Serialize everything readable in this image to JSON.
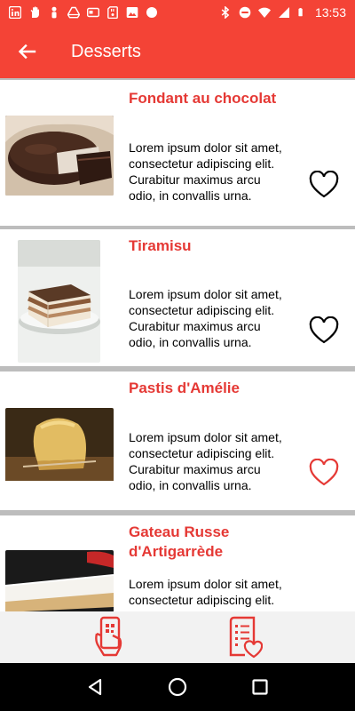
{
  "status_bar": {
    "time": "13:53",
    "left_icons": [
      "linkedin-icon",
      "hand-icon",
      "person-icon",
      "drive-icon",
      "card-icon",
      "sd-card-icon",
      "image-icon",
      "circle-icon"
    ],
    "right_icons": [
      "bluetooth-icon",
      "do-not-disturb-icon",
      "wifi-icon",
      "signal-icon",
      "battery-icon"
    ]
  },
  "app_bar": {
    "title": "Desserts",
    "back_icon": "arrow-back-icon",
    "color": "#f44336"
  },
  "items": [
    {
      "title": "Fondant au chocolat",
      "description": "Lorem ipsum dolor sit amet, consectetur adipiscing elit. Curabitur maximus arcu odio, in convallis urna.",
      "favorite": false
    },
    {
      "title": "Tiramisu",
      "description": "Lorem ipsum dolor sit amet, consectetur adipiscing elit. Curabitur maximus arcu odio, in convallis urna.",
      "favorite": false
    },
    {
      "title": "Pastis d'Amélie",
      "description": "Lorem ipsum dolor sit amet, consectetur adipiscing elit. Curabitur maximus arcu odio, in convallis urna.",
      "favorite": true
    },
    {
      "title": "Gateau Russe d'Artigarrède",
      "description": "Lorem ipsum dolor sit amet, consectetur adipiscing elit. Curabitur maximus arcu odio, in convallis urna.",
      "favorite": false
    }
  ],
  "bottom_bar": {
    "tabs": [
      {
        "icon": "phone-qr-hand-icon"
      },
      {
        "icon": "favorites-list-icon"
      }
    ],
    "accent": "#e53935"
  },
  "nav_bar": {
    "buttons": [
      "back-triangle-icon",
      "home-circle-icon",
      "recents-square-icon"
    ]
  }
}
